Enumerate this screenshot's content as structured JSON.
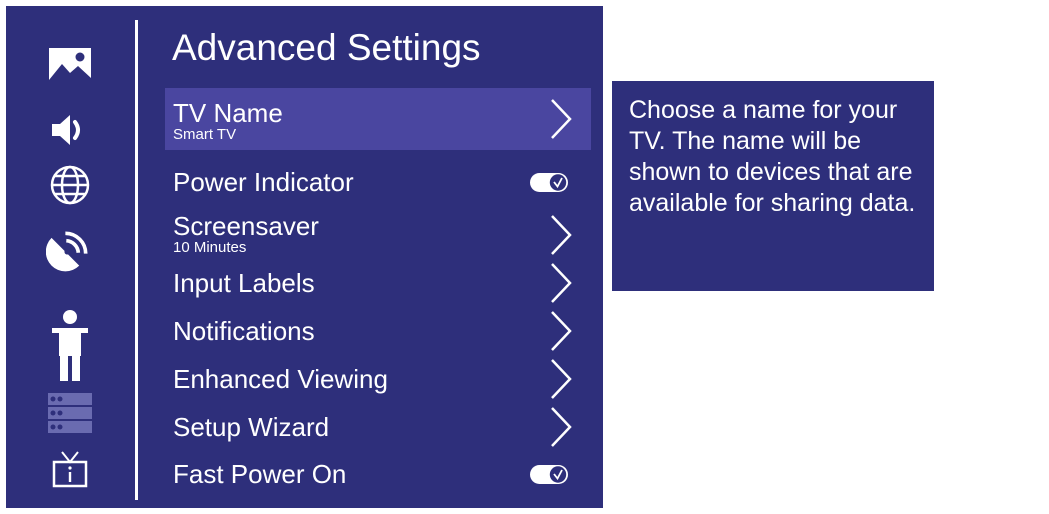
{
  "page": {
    "title": "Advanced Settings"
  },
  "sidebar": {
    "items": [
      {
        "icon": "picture-icon"
      },
      {
        "icon": "audio-icon"
      },
      {
        "icon": "network-icon"
      },
      {
        "icon": "channels-icon"
      },
      {
        "icon": "accessibility-icon"
      },
      {
        "icon": "inputs-icon"
      },
      {
        "icon": "system-icon"
      }
    ]
  },
  "menu": {
    "items": [
      {
        "label": "TV Name",
        "sub": "Smart TV",
        "control": "chevron",
        "selected": true
      },
      {
        "label": "Power Indicator",
        "control": "toggle",
        "checked": true
      },
      {
        "label": "Screensaver",
        "sub": "10 Minutes",
        "control": "chevron"
      },
      {
        "label": "Input Labels",
        "control": "chevron"
      },
      {
        "label": "Notifications",
        "control": "chevron"
      },
      {
        "label": "Enhanced Viewing",
        "control": "chevron"
      },
      {
        "label": "Setup Wizard",
        "control": "chevron"
      },
      {
        "label": "Fast Power On",
        "control": "toggle",
        "checked": true
      }
    ]
  },
  "help": {
    "text": "Choose a name for your TV. The name will be shown to devices that are available for sharing data."
  },
  "colors": {
    "background": "#2e2f7b",
    "selected": "#4a46a0",
    "text": "#ffffff",
    "panel": "#ffffff"
  }
}
